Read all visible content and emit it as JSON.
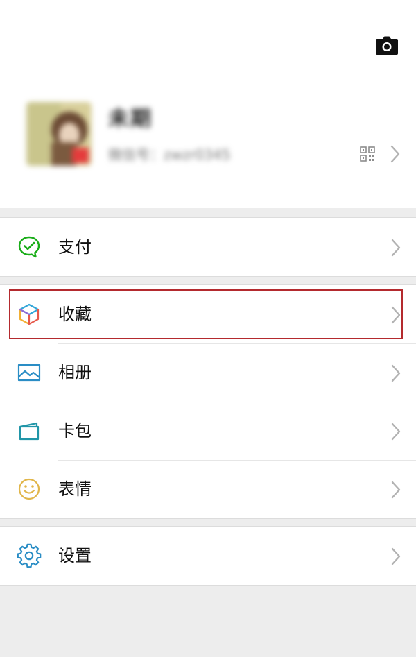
{
  "profile": {
    "nickname": "未期",
    "wechat_id": "微信号：zwzr0345"
  },
  "groups": [
    {
      "items": [
        {
          "label": "支付",
          "icon": "wechat-pay-icon"
        }
      ]
    },
    {
      "items": [
        {
          "label": "收藏",
          "icon": "favorites-cube-icon",
          "highlighted": true
        },
        {
          "label": "相册",
          "icon": "album-image-icon"
        },
        {
          "label": "卡包",
          "icon": "card-wallet-icon"
        },
        {
          "label": "表情",
          "icon": "smiley-emoji-icon"
        }
      ]
    },
    {
      "items": [
        {
          "label": "设置",
          "icon": "settings-gear-icon"
        }
      ]
    }
  ],
  "colors": {
    "page_background": "#ededed",
    "panel_background": "#ffffff",
    "pay_green": "#1aad19",
    "highlight_red": "#b42a2e",
    "chevron_grey": "#b2b2b2"
  }
}
